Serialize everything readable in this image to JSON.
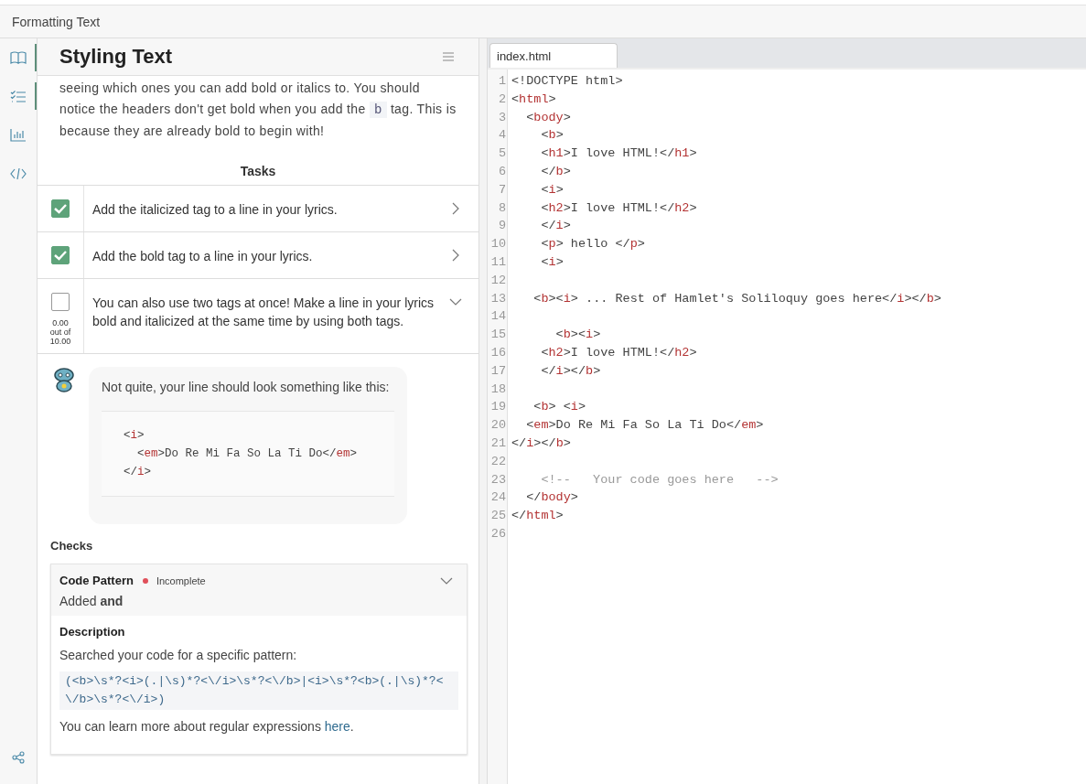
{
  "window": {
    "title": "Formatting Text"
  },
  "rail": [
    {
      "kind": "book",
      "selected": true
    },
    {
      "kind": "tasks",
      "selected": true
    },
    {
      "kind": "chart",
      "selected": false
    },
    {
      "kind": "code",
      "selected": false
    }
  ],
  "panel": {
    "title": "Styling Text",
    "intro": [
      {
        "before": "seeing which ones you can add bold or italics to. You should notice the headers don't get bold when you add the ",
        "code": "b",
        "after": " tag. This is because they are already bold to begin with!"
      }
    ],
    "tasks_heading": "Tasks",
    "tasks": [
      {
        "text": "Add the italicized tag to a line in your lyrics.",
        "checked": true,
        "expanded": false
      },
      {
        "text": "Add the bold tag to a line in your lyrics.",
        "checked": true,
        "expanded": false
      },
      {
        "text": "You can also use two tags at once! Make a line in your lyrics bold and italicized at the same time by using both tags.",
        "checked": false,
        "expanded": true,
        "score": [
          "0.00",
          "out of",
          "10.00"
        ]
      }
    ],
    "feedback": {
      "message": "Not quite, your line should look something like this:",
      "code": [
        "<i>",
        "  <em>Do Re Mi Fa So La Ti Do</em>",
        "</i>"
      ]
    },
    "checks_heading": "Checks",
    "check": {
      "name": "Code Pattern",
      "status": "Incomplete",
      "summary": "Added **and**",
      "description_heading": "Description",
      "description": "Searched your code for a specific pattern:",
      "pattern": "(<b>\\s*?<i>(.|\\s)*?<\\/i>\\s*?<\\/b>|<i>\\s*?<b>(.|\\s)*?<\\/b>\\s*?<\\/i>)",
      "learn_before": "You can learn more about regular expressions ",
      "learn_link": "here",
      "learn_after": "."
    }
  },
  "editor": {
    "tabs": [
      {
        "label": "index.html",
        "selected": true
      }
    ],
    "lines": [
      {
        "number": "1",
        "code": "<!DOCTYPE html>",
        "kind": "doctype"
      },
      {
        "number": "2",
        "code": "<html>",
        "kind": "code"
      },
      {
        "number": "3",
        "code": "  <body>",
        "kind": "code"
      },
      {
        "number": "4",
        "code": "    <b>",
        "kind": "code"
      },
      {
        "number": "5",
        "code": "    <h1>I love HTML!</h1>",
        "kind": "code"
      },
      {
        "number": "6",
        "code": "    </b>",
        "kind": "code"
      },
      {
        "number": "7",
        "code": "    <i>",
        "kind": "code"
      },
      {
        "number": "8",
        "code": "    <h2>I love HTML!</h2>",
        "kind": "code"
      },
      {
        "number": "9",
        "code": "    </i>",
        "kind": "code"
      },
      {
        "number": "10",
        "code": "    <p> hello </p>",
        "kind": "code"
      },
      {
        "number": "11",
        "code": "    <i>",
        "kind": "code"
      },
      {
        "number": "12"
      },
      {
        "number": "13",
        "code": "   <b><i> ... Rest of Hamlet's Soliloquy goes here</i></b>",
        "kind": "code"
      },
      {
        "number": "14"
      },
      {
        "number": "15",
        "code": "      <b><i>",
        "kind": "code"
      },
      {
        "number": "16",
        "code": "    <h2>I love HTML!</h2>",
        "kind": "code"
      },
      {
        "number": "17",
        "code": "    </i></b>",
        "kind": "code"
      },
      {
        "number": "18"
      },
      {
        "number": "19",
        "code": "   <b> <i>",
        "kind": "code"
      },
      {
        "number": "20",
        "code": "  <em>Do Re Mi Fa So La Ti Do</em>",
        "kind": "code"
      },
      {
        "number": "21",
        "code": "</i></b>",
        "kind": "code"
      },
      {
        "number": "22"
      },
      {
        "number": "23",
        "code": "    <!--   Your code goes here   -->",
        "kind": "comment"
      },
      {
        "number": "24",
        "code": "  </body>",
        "kind": "code"
      },
      {
        "number": "25",
        "code": "</html>",
        "kind": "code"
      },
      {
        "number": "26"
      }
    ]
  }
}
